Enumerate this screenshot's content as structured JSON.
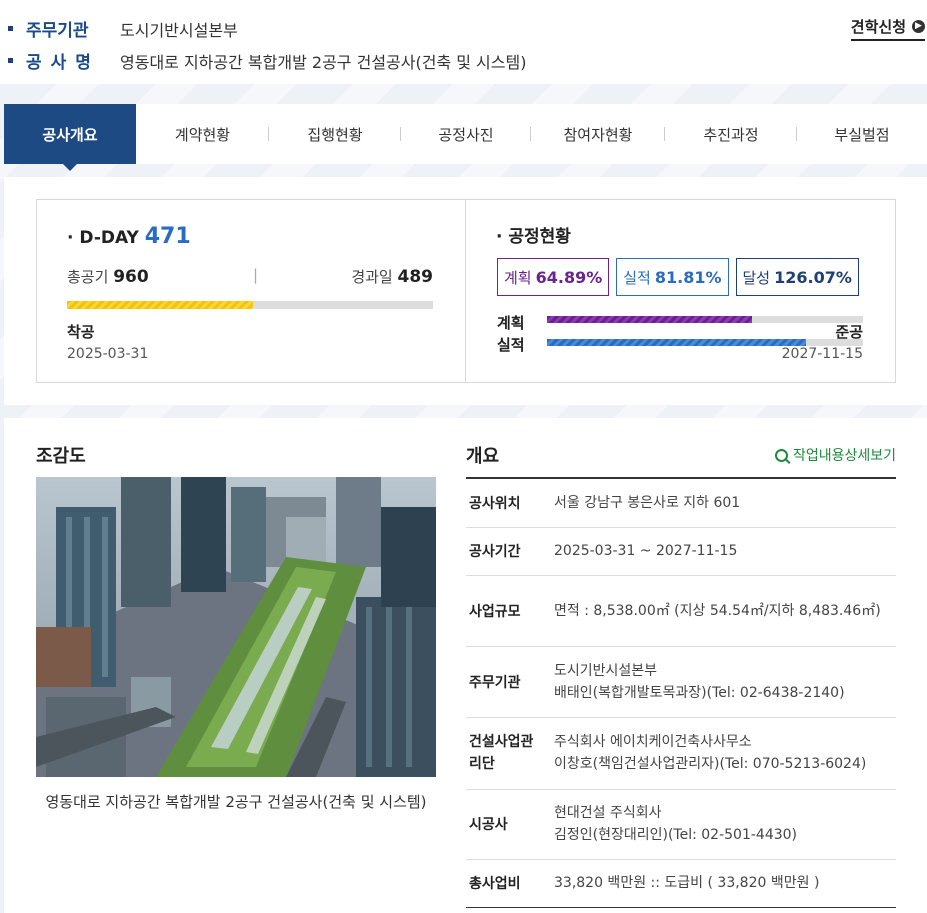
{
  "header": {
    "org_label": "주무기관",
    "org_value": "도시기반시설본부",
    "project_label": "공사명",
    "project_value": "영동대로 지하공간 복합개발 2공구 건설공사(건축 및 시스템)",
    "visit_button": "견학신청",
    "visit_icon": "chevron-right-icon"
  },
  "tabs": [
    {
      "label": "공사개요",
      "active": true
    },
    {
      "label": "계약현황"
    },
    {
      "label": "집행현황"
    },
    {
      "label": "공정사진"
    },
    {
      "label": "참여자현황"
    },
    {
      "label": "추진과정"
    },
    {
      "label": "부실벌점"
    }
  ],
  "status": {
    "dday_label": "D-DAY",
    "dday_value": "471",
    "total_label": "총공기",
    "total_value": "960",
    "separator": "|",
    "elapsed_label": "경과일",
    "elapsed_value": "489",
    "elapsed_fraction": 0.509,
    "start_label": "착공",
    "start_date": "2025-03-31",
    "end_label": "준공",
    "end_date": "2027-11-15"
  },
  "process": {
    "title": "공정현황",
    "plan_label": "계획",
    "plan_value": "64.89%",
    "plan_fraction": 0.6489,
    "actual_label": "실적",
    "actual_value": "81.81%",
    "actual_fraction": 0.8181,
    "achieve_label": "달성",
    "achieve_value": "126.07%",
    "bar_plan_label": "계획",
    "bar_actual_label": "실적",
    "plan_color": "#6a1f93",
    "actual_color": "#2a6bc3"
  },
  "bird_view": {
    "title": "조감도",
    "caption": "영동대로 지하공간 복합개발 2공구 건설공사(건축 및 시스템)"
  },
  "overview": {
    "title": "개요",
    "detail_link": "작업내용상세보기",
    "detail_icon": "magnifier-plus-icon",
    "rows": [
      {
        "key": "공사위치",
        "lines": [
          "서울 강남구 봉은사로 지하 601"
        ]
      },
      {
        "key": "공사기간",
        "lines": [
          "2025-03-31 ~ 2027-11-15"
        ]
      },
      {
        "key": "사업규모",
        "lines": [
          "면적 : 8,538.00㎡ (지상 54.54㎡/지하 8,483.46㎡)"
        ]
      },
      {
        "key": "주무기관",
        "lines": [
          "도시기반시설본부",
          "배태인(복합개발토목과장)(Tel: 02-6438-2140)"
        ]
      },
      {
        "key": "건설사업관리단",
        "lines": [
          "주식회사 에이치케이건축사사무소",
          "이창호(책임건설사업관리자)(Tel: 070-5213-6024)"
        ]
      },
      {
        "key": "시공사",
        "lines": [
          "현대건설 주식회사",
          "김정인(현장대리인)(Tel: 02-501-4430)"
        ]
      },
      {
        "key": "총사업비",
        "lines": [
          "33,820 백만원 :: 도급비 ( 33,820 백만원 )"
        ]
      }
    ]
  }
}
